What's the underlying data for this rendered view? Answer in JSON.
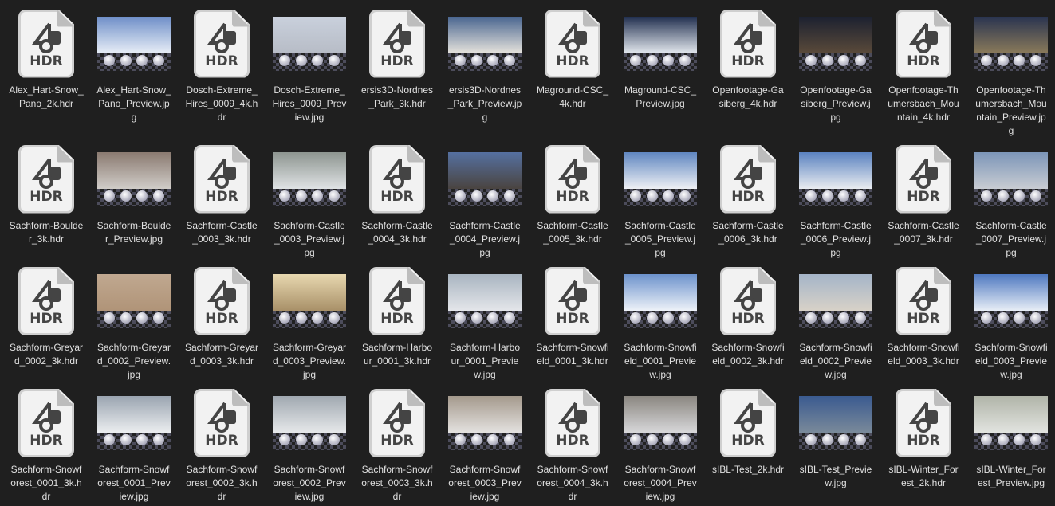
{
  "hdr_icon_label": "HDR",
  "files": [
    {
      "name": "Alex_Hart-Snow_Pano_2k.hdr",
      "type": "hdr"
    },
    {
      "name": "Alex_Hart-Snow_Pano_Preview.jpg",
      "type": "jpg",
      "sky": "#6f8fc8",
      "ground": "#e8eef6"
    },
    {
      "name": "Dosch-Extreme_Hires_0009_4k.hdr",
      "type": "hdr"
    },
    {
      "name": "Dosch-Extreme_Hires_0009_Preview.jpg",
      "type": "jpg",
      "sky": "#c9d0dc",
      "ground": "#b7bcc6"
    },
    {
      "name": "ersis3D-Nordnes_Park_3k.hdr",
      "type": "hdr"
    },
    {
      "name": "ersis3D-Nordnes_Park_Preview.jpg",
      "type": "jpg",
      "sky": "#4a6690",
      "ground": "#e6e3dc"
    },
    {
      "name": "Maground-CSC_4k.hdr",
      "type": "hdr"
    },
    {
      "name": "Maground-CSC_Preview.jpg",
      "type": "jpg",
      "sky": "#223050",
      "ground": "#e3e8ee"
    },
    {
      "name": "Openfootage-Gasiberg_4k.hdr",
      "type": "hdr"
    },
    {
      "name": "Openfootage-Gasiberg_Preview.jpg",
      "type": "jpg",
      "sky": "#1c2130",
      "ground": "#5a4a3a"
    },
    {
      "name": "Openfootage-Thumersbach_Mountain_4k.hdr",
      "type": "hdr"
    },
    {
      "name": "Openfootage-Thumersbach_Mountain_Preview.jpg",
      "type": "jpg",
      "sky": "#2a3450",
      "ground": "#8a7a5a"
    },
    {
      "name": "Sachform-Boulder_3k.hdr",
      "type": "hdr"
    },
    {
      "name": "Sachform-Boulder_Preview.jpg",
      "type": "jpg",
      "sky": "#8a7a70",
      "ground": "#d0ccc8"
    },
    {
      "name": "Sachform-Castle_0003_3k.hdr",
      "type": "hdr"
    },
    {
      "name": "Sachform-Castle_0003_Preview.jpg",
      "type": "jpg",
      "sky": "#8d9590",
      "ground": "#dfe2e4"
    },
    {
      "name": "Sachform-Castle_0004_3k.hdr",
      "type": "hdr"
    },
    {
      "name": "Sachform-Castle_0004_Preview.jpg",
      "type": "jpg",
      "sky": "#5570a0",
      "ground": "#4a4440"
    },
    {
      "name": "Sachform-Castle_0005_3k.hdr",
      "type": "hdr"
    },
    {
      "name": "Sachform-Castle_0005_Preview.jpg",
      "type": "jpg",
      "sky": "#5f86c0",
      "ground": "#eef0f4"
    },
    {
      "name": "Sachform-Castle_0006_3k.hdr",
      "type": "hdr"
    },
    {
      "name": "Sachform-Castle_0006_Preview.jpg",
      "type": "jpg",
      "sky": "#5a82c0",
      "ground": "#e9ecf0"
    },
    {
      "name": "Sachform-Castle_0007_3k.hdr",
      "type": "hdr"
    },
    {
      "name": "Sachform-Castle_0007_Preview.jpg",
      "type": "jpg",
      "sky": "#7c95b8",
      "ground": "#c8ccd2"
    },
    {
      "name": "Sachform-Greyard_0002_3k.hdr",
      "type": "hdr"
    },
    {
      "name": "Sachform-Greyard_0002_Preview.jpg",
      "type": "jpg",
      "sky": "#c0a890",
      "ground": "#b09478"
    },
    {
      "name": "Sachform-Greyard_0003_3k.hdr",
      "type": "hdr"
    },
    {
      "name": "Sachform-Greyard_0003_Preview.jpg",
      "type": "jpg",
      "sky": "#e8d8b0",
      "ground": "#a89068"
    },
    {
      "name": "Sachform-Harbour_0001_3k.hdr",
      "type": "hdr"
    },
    {
      "name": "Sachform-Harbour_0001_Preview.jpg",
      "type": "jpg",
      "sky": "#a8b4c0",
      "ground": "#e4e6ea"
    },
    {
      "name": "Sachform-Snowfield_0001_3k.hdr",
      "type": "hdr"
    },
    {
      "name": "Sachform-Snowfield_0001_Preview.jpg",
      "type": "jpg",
      "sky": "#6c92cc",
      "ground": "#eef2f8"
    },
    {
      "name": "Sachform-Snowfield_0002_3k.hdr",
      "type": "hdr"
    },
    {
      "name": "Sachform-Snowfield_0002_Preview.jpg",
      "type": "jpg",
      "sky": "#a4b4c8",
      "ground": "#d8d2c8"
    },
    {
      "name": "Sachform-Snowfield_0003_3k.hdr",
      "type": "hdr"
    },
    {
      "name": "Sachform-Snowfield_0003_Preview.jpg",
      "type": "jpg",
      "sky": "#4e78c0",
      "ground": "#e8eef6"
    },
    {
      "name": "Sachform-Snowforest_0001_3k.hdr",
      "type": "hdr"
    },
    {
      "name": "Sachform-Snowforest_0001_Preview.jpg",
      "type": "jpg",
      "sky": "#9aa4b0",
      "ground": "#eceef0"
    },
    {
      "name": "Sachform-Snowforest_0002_3k.hdr",
      "type": "hdr"
    },
    {
      "name": "Sachform-Snowforest_0002_Preview.jpg",
      "type": "jpg",
      "sky": "#a0a8b0",
      "ground": "#e6e8ea"
    },
    {
      "name": "Sachform-Snowforest_0003_3k.hdr",
      "type": "hdr"
    },
    {
      "name": "Sachform-Snowforest_0003_Preview.jpg",
      "type": "jpg",
      "sky": "#a4998c",
      "ground": "#e4e2e0"
    },
    {
      "name": "Sachform-Snowforest_0004_3k.hdr",
      "type": "hdr"
    },
    {
      "name": "Sachform-Snowforest_0004_Preview.jpg",
      "type": "jpg",
      "sky": "#8a8680",
      "ground": "#d8d8da"
    },
    {
      "name": "sIBL-Test_2k.hdr",
      "type": "hdr"
    },
    {
      "name": "sIBL-Test_Preview.jpg",
      "type": "jpg",
      "sky": "#3a5a90",
      "ground": "#7a8a9a"
    },
    {
      "name": "sIBL-Winter_Forest_2k.hdr",
      "type": "hdr"
    },
    {
      "name": "sIBL-Winter_Forest_Preview.jpg",
      "type": "jpg",
      "sky": "#b0b4a8",
      "ground": "#e2e4e0"
    }
  ]
}
